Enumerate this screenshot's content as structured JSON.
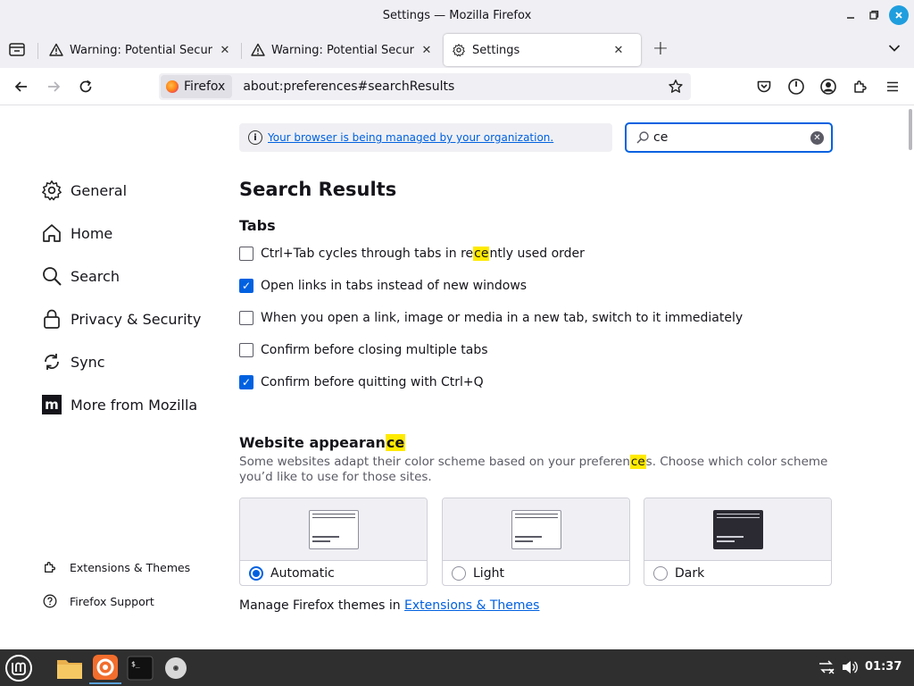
{
  "window": {
    "title": "Settings — Mozilla Firefox"
  },
  "tabs": [
    {
      "label": "Warning: Potential Security Risk Ahead",
      "icon": "warning-icon"
    },
    {
      "label": "Warning: Potential Security Risk Ahead",
      "icon": "warning-icon"
    },
    {
      "label": "Settings",
      "icon": "gear-icon",
      "active": true
    }
  ],
  "urlbar": {
    "identity_label": "Firefox",
    "url": "about:preferences#searchResults"
  },
  "policy": {
    "text": "Your browser is being managed by your organization."
  },
  "search": {
    "value": "ce"
  },
  "sidebar": {
    "items": [
      {
        "label": "General",
        "icon": "gear-icon"
      },
      {
        "label": "Home",
        "icon": "home-icon"
      },
      {
        "label": "Search",
        "icon": "search-icon"
      },
      {
        "label": "Privacy & Security",
        "icon": "lock-icon"
      },
      {
        "label": "Sync",
        "icon": "sync-icon"
      },
      {
        "label": "More from Mozilla",
        "icon": "mozilla-icon"
      }
    ],
    "footer": [
      {
        "label": "Extensions & Themes",
        "icon": "puzzle-icon"
      },
      {
        "label": "Firefox Support",
        "icon": "help-icon"
      }
    ]
  },
  "main": {
    "heading": "Search Results",
    "tabs_heading": "Tabs",
    "checkboxes": [
      {
        "pre": "Ctrl+Tab cycles through tabs in re",
        "hl": "ce",
        "post": "ntly used order",
        "checked": false
      },
      {
        "pre": "Open links in tabs instead of new windows",
        "hl": "",
        "post": "",
        "checked": true
      },
      {
        "pre": "When you open a link, image or media in a new tab, switch to it immediately",
        "hl": "",
        "post": "",
        "checked": false
      },
      {
        "pre": "Confirm before closing multiple tabs",
        "hl": "",
        "post": "",
        "checked": false
      },
      {
        "pre": "Confirm before quitting with Ctrl+Q",
        "hl": "",
        "post": "",
        "checked": true
      }
    ],
    "appearance_heading_pre": "Website appearan",
    "appearance_heading_hl": "ce",
    "appearance_desc_pre": "Some websites adapt their color scheme based on your preferen",
    "appearance_desc_hl": "ce",
    "appearance_desc_post": "s. Choose which color scheme you’d like to use for those sites.",
    "themes": [
      {
        "label": "Automatic",
        "selected": true
      },
      {
        "label": "Light",
        "selected": false
      },
      {
        "label": "Dark",
        "selected": false
      }
    ],
    "manage_text": "Manage Firefox themes in ",
    "manage_link": "Extensions & Themes"
  },
  "taskbar": {
    "clock": "01:37"
  },
  "colors": {
    "accent": "#0061e0",
    "highlight": "#ffea00",
    "taskbar": "#2f2f2f"
  }
}
